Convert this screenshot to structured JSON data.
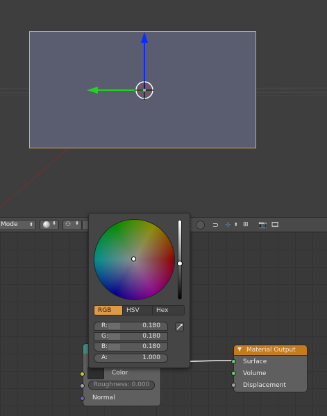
{
  "viewport": {
    "header": {
      "mode_label": "Mode"
    }
  },
  "color_picker": {
    "tabs": [
      {
        "label": "RGB",
        "active": true
      },
      {
        "label": "HSV",
        "active": false
      },
      {
        "label": "Hex",
        "active": false
      }
    ],
    "fields": [
      {
        "label": "R:",
        "value": "0.180"
      },
      {
        "label": "G:",
        "value": "0.180"
      },
      {
        "label": "B:",
        "value": "0.180"
      },
      {
        "label": "A:",
        "value": "1.000"
      }
    ],
    "value_level": 0.5
  },
  "shader_node": {
    "color_label": "Color",
    "roughness_field": "Roughness: 0.000",
    "normal_label": "Normal"
  },
  "material_output_node": {
    "title": "Material Output",
    "sockets": [
      "Surface",
      "Volume",
      "Displacement"
    ]
  },
  "colors": {
    "accent_orange": "#e19a44",
    "socket_green": "#6dc56d",
    "socket_yellow": "#c7c729",
    "socket_grey": "#a1a1a1",
    "socket_blue": "#6363c7",
    "axis_blue": "#0a2cff",
    "axis_green": "#1fd51f",
    "plane_fill": "#5a5d70"
  }
}
